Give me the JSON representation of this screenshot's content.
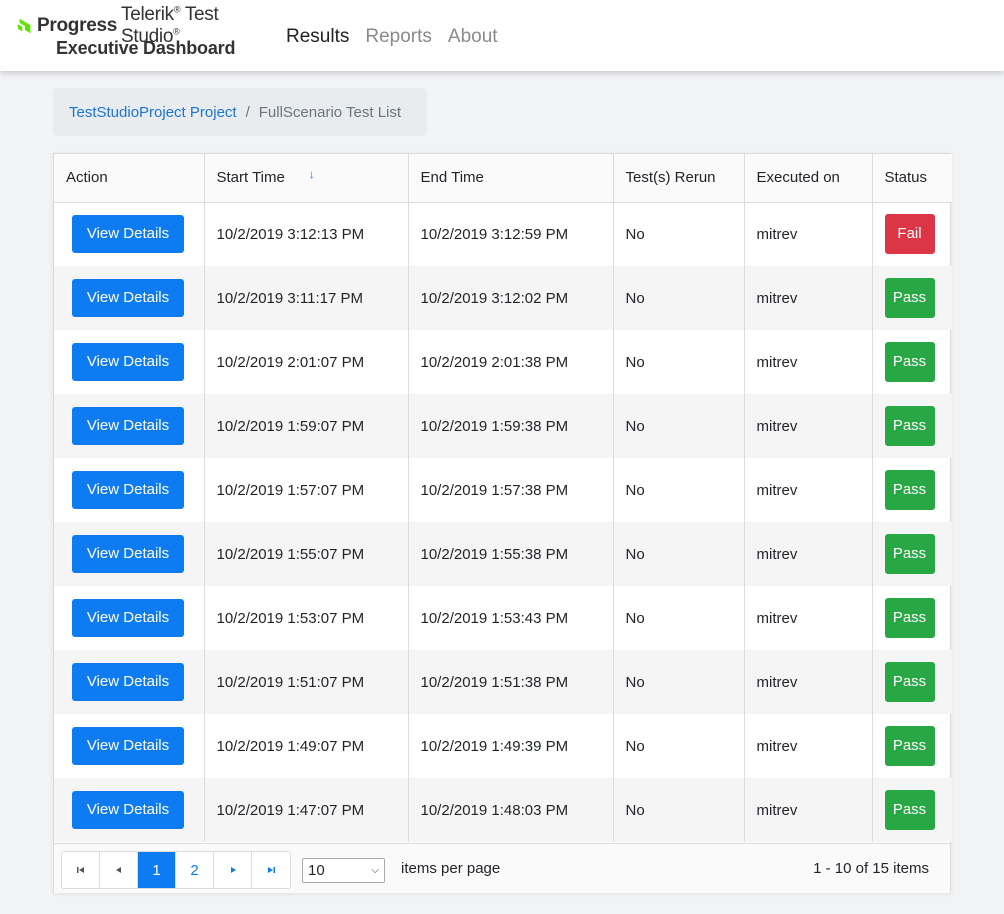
{
  "header": {
    "brand_progress": "Progress",
    "brand_product": "Telerik",
    "brand_product2": "Test Studio",
    "brand_subtitle": "Executive Dashboard",
    "nav": [
      {
        "label": "Results",
        "active": true
      },
      {
        "label": "Reports",
        "active": false
      },
      {
        "label": "About",
        "active": false
      }
    ]
  },
  "breadcrumb": {
    "link": "TestStudioProject Project",
    "separator": "/",
    "current": "FullScenario Test List"
  },
  "table": {
    "columns": [
      "Action",
      "Start Time",
      "End Time",
      "Test(s) Rerun",
      "Executed on",
      "Status"
    ],
    "sort_indicator": "↓",
    "button_label": "View Details",
    "rows": [
      {
        "start": "10/2/2019 3:12:13 PM",
        "end": "10/2/2019 3:12:59 PM",
        "rerun": "No",
        "executed_on": "mitrev",
        "status": "Fail"
      },
      {
        "start": "10/2/2019 3:11:17 PM",
        "end": "10/2/2019 3:12:02 PM",
        "rerun": "No",
        "executed_on": "mitrev",
        "status": "Pass"
      },
      {
        "start": "10/2/2019 2:01:07 PM",
        "end": "10/2/2019 2:01:38 PM",
        "rerun": "No",
        "executed_on": "mitrev",
        "status": "Pass"
      },
      {
        "start": "10/2/2019 1:59:07 PM",
        "end": "10/2/2019 1:59:38 PM",
        "rerun": "No",
        "executed_on": "mitrev",
        "status": "Pass"
      },
      {
        "start": "10/2/2019 1:57:07 PM",
        "end": "10/2/2019 1:57:38 PM",
        "rerun": "No",
        "executed_on": "mitrev",
        "status": "Pass"
      },
      {
        "start": "10/2/2019 1:55:07 PM",
        "end": "10/2/2019 1:55:38 PM",
        "rerun": "No",
        "executed_on": "mitrev",
        "status": "Pass"
      },
      {
        "start": "10/2/2019 1:53:07 PM",
        "end": "10/2/2019 1:53:43 PM",
        "rerun": "No",
        "executed_on": "mitrev",
        "status": "Pass"
      },
      {
        "start": "10/2/2019 1:51:07 PM",
        "end": "10/2/2019 1:51:38 PM",
        "rerun": "No",
        "executed_on": "mitrev",
        "status": "Pass"
      },
      {
        "start": "10/2/2019 1:49:07 PM",
        "end": "10/2/2019 1:49:39 PM",
        "rerun": "No",
        "executed_on": "mitrev",
        "status": "Pass"
      },
      {
        "start": "10/2/2019 1:47:07 PM",
        "end": "10/2/2019 1:48:03 PM",
        "rerun": "No",
        "executed_on": "mitrev",
        "status": "Pass"
      }
    ]
  },
  "pager": {
    "first_icon": "first-page-icon",
    "prev_icon": "prev-page-icon",
    "next_icon": "next-page-icon",
    "last_icon": "last-page-icon",
    "pages": [
      "1",
      "2"
    ],
    "current_page": "1",
    "page_size": "10",
    "items_per_page_label": "items per page",
    "info": "1 - 10 of 15 items"
  },
  "colors": {
    "primary": "#0d7cf2",
    "fail": "#dc3545",
    "pass": "#28a745",
    "logo_green": "#5ce500"
  }
}
